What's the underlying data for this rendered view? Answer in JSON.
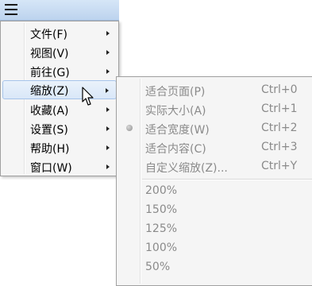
{
  "menu_button": {
    "icon": "hamburger-icon"
  },
  "main_menu": {
    "items": [
      {
        "label": "文件(F)"
      },
      {
        "label": "视图(V)"
      },
      {
        "label": "前往(G)"
      },
      {
        "label": "缩放(Z)"
      },
      {
        "label": "收藏(A)"
      },
      {
        "label": "设置(S)"
      },
      {
        "label": "帮助(H)"
      },
      {
        "label": "窗口(W)"
      }
    ],
    "highlighted_index": 3
  },
  "zoom_menu": {
    "items": [
      {
        "label": "适合页面(P)",
        "shortcut": "Ctrl+0"
      },
      {
        "label": "实际大小(A)",
        "shortcut": "Ctrl+1"
      },
      {
        "label": "适合宽度(W)",
        "shortcut": "Ctrl+2",
        "selected": true
      },
      {
        "label": "适合内容(C)",
        "shortcut": "Ctrl+3"
      },
      {
        "label": "自定义缩放(Z)...",
        "shortcut": "Ctrl+Y"
      }
    ],
    "presets": [
      {
        "label": "200%"
      },
      {
        "label": "150%"
      },
      {
        "label": "125%"
      },
      {
        "label": "100%"
      },
      {
        "label": "50%"
      }
    ]
  }
}
